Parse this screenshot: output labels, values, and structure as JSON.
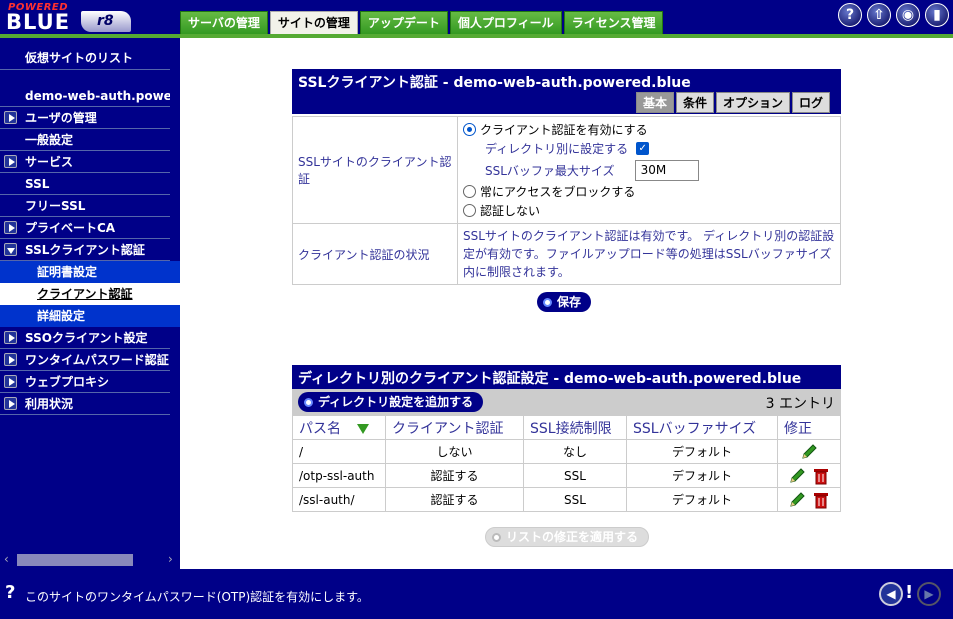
{
  "logo": {
    "powered": "POWERED",
    "blue": "BLUE",
    "version": "r8"
  },
  "header": {
    "tabs": [
      {
        "label": "サーバの管理",
        "active": false
      },
      {
        "label": "サイトの管理",
        "active": true
      },
      {
        "label": "アップデート",
        "active": false
      },
      {
        "label": "個人プロフィール",
        "active": false
      },
      {
        "label": "ライセンス管理",
        "active": false
      }
    ],
    "icons": [
      "help-icon",
      "logout-icon",
      "view-icon",
      "exit-icon"
    ]
  },
  "sidebar": {
    "virtual_sites": "仮想サイトのリスト",
    "site_name": "demo-web-auth.powered.blue",
    "items": {
      "users": "ユーザの管理",
      "general": "一般設定",
      "services": "サービス",
      "ssl": "SSL",
      "free_ssl": "フリーSSL",
      "private_ca": "プライベートCA",
      "ssl_client_auth": "SSLクライアント認証",
      "cert_settings": "証明書設定",
      "client_auth": "クライアント認証",
      "detail_settings": "詳細設定",
      "sso_client_settings": "SSOクライアント設定",
      "otp_auth": "ワンタイムパスワード認証",
      "web_proxy": "ウェブプロキシ",
      "usage": "利用状況"
    }
  },
  "panel1": {
    "title": "SSLクライアント認証 - demo-web-auth.powered.blue",
    "subtabs": [
      "基本",
      "条件",
      "オプション",
      "ログ"
    ],
    "ssl_label": "SSLサイトのクライアント認証",
    "opt_enable": "クライアント認証を有効にする",
    "opt_per_dir": "ディレクトリ別に設定する",
    "opt_buffer": "SSLバッファ最大サイズ",
    "buffer_value": "30M",
    "opt_block": "常にアクセスをブロックする",
    "opt_none": "認証しない",
    "status_label": "クライアント認証の状況",
    "status_text": "SSLサイトのクライアント認証は有効です。 ディレクトリ別の認証設定が有効です。ファイルアップロード等の処理はSSLバッファサイズ内に制限されます。",
    "save": "保存"
  },
  "panel2": {
    "title": "ディレクトリ別のクライアント認証設定 - demo-web-auth.powered.blue",
    "add_button": "ディレクトリ設定を追加する",
    "count": "3 エントリ",
    "columns": [
      "パス名",
      "クライアント認証",
      "SSL接続制限",
      "SSLバッファサイズ",
      "修正"
    ],
    "rows": [
      {
        "path": "/",
        "auth": "しない",
        "limit": "なし",
        "buffer": "デフォルト"
      },
      {
        "path": "/otp-ssl-auth",
        "auth": "認証する",
        "limit": "SSL",
        "buffer": "デフォルト"
      },
      {
        "path": "/ssl-auth/",
        "auth": "認証する",
        "limit": "SSL",
        "buffer": "デフォルト"
      }
    ],
    "apply": "リストの修正を適用する"
  },
  "footer": {
    "help_mark": "?",
    "message": "このサイトのワンタイムパスワード(OTP)認証を有効にします。"
  },
  "colors": {
    "navy": "#000088",
    "green": "#55aa33",
    "link_blue": "#333399"
  }
}
